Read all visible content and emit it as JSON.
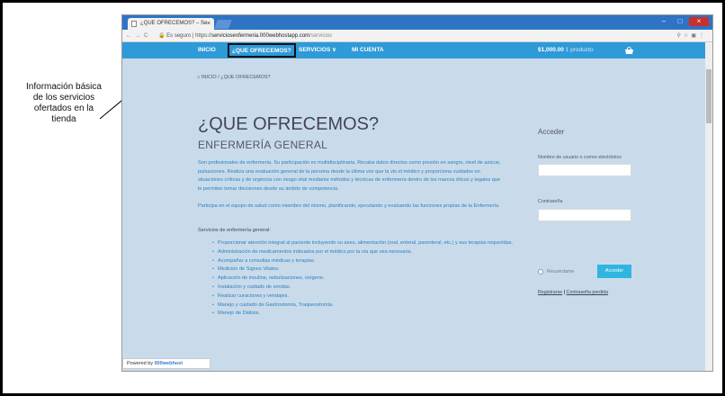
{
  "annotation": {
    "text": "Información básica de los servicios ofertados en la tienda"
  },
  "browser": {
    "tab_title": "¿QUE OFRECEMOS? – Se",
    "tab_close": "×",
    "window_controls": [
      "–",
      "□",
      "×"
    ],
    "url_secure": "Es seguro",
    "url_scheme": "https://",
    "url_host": "serviciosenfermeria.000webhostapp.com",
    "url_path": "/servicios"
  },
  "nav": {
    "items": [
      {
        "label": "INICIO"
      },
      {
        "label": "¿QUE OFRECEMOS?"
      },
      {
        "label": "SERVICIOS  ∨"
      },
      {
        "label": "MI CUENTA"
      }
    ],
    "cart_amount": "$1,000.00",
    "cart_count": "1 producto"
  },
  "breadcrumb": {
    "home": "INICIO",
    "current": "¿QUE OFRECEMOS?"
  },
  "content": {
    "title": "¿QUE OFRECEMOS?",
    "subtitle": "ENFERMERÍA GENERAL",
    "paragraph1": "Son profesionales de enfermería. Su participación es multidisciplinaria. Recaba datos directos como presión en sangre, nivel de azúcar, pulsaciones. Realiza una evaluación general de la persona desde la última vez que la vio el médico y proporciona cuidados en situaciones críticas y de urgencia con riesgo vital mediante métodos y técnicas de enfermería dentro de los marcos éticos y legales que le permiten tomar decisiones desde su ámbito de competencia.",
    "paragraph2": "Participa en el equipo de salud como miembro del mismo, planificando, ejecutando y evaluando las funciones propias de la Enfermería.",
    "services_heading": "Servicios de enfermería general:",
    "services": [
      "Proporcionar atención integral al paciente incluyendo su aseo, alimentación (oral, enteral, parenteral, etc.) y sus terapias requeridas.",
      "Administración de medicamentos indicados por el médico por la vía que sea necesaria.",
      "Acompañar a consultas médicas y terapias.",
      "Medición de Signos Vitales.",
      "Aplicación de insulina, nebulizaciones, oxígeno.",
      "Instalación y cuidado de sondas.",
      "Realizar curaciones y vendajes.",
      "Manejo y cuidado de Gastrostomía, Traqueostomía.",
      "Manejo de Diálisis."
    ]
  },
  "login": {
    "heading": "Acceder",
    "username_label": "Nombre de usuario o correo electrónico",
    "password_label": "Contraseña",
    "remember_label": "Recuérdame",
    "submit_label": "Acceder",
    "register_link": "Registrarse",
    "separator": "|",
    "lost_password_link": "Contraseña perdida"
  },
  "footer": {
    "powered_by": "Powered by",
    "brand": "000webhost"
  }
}
